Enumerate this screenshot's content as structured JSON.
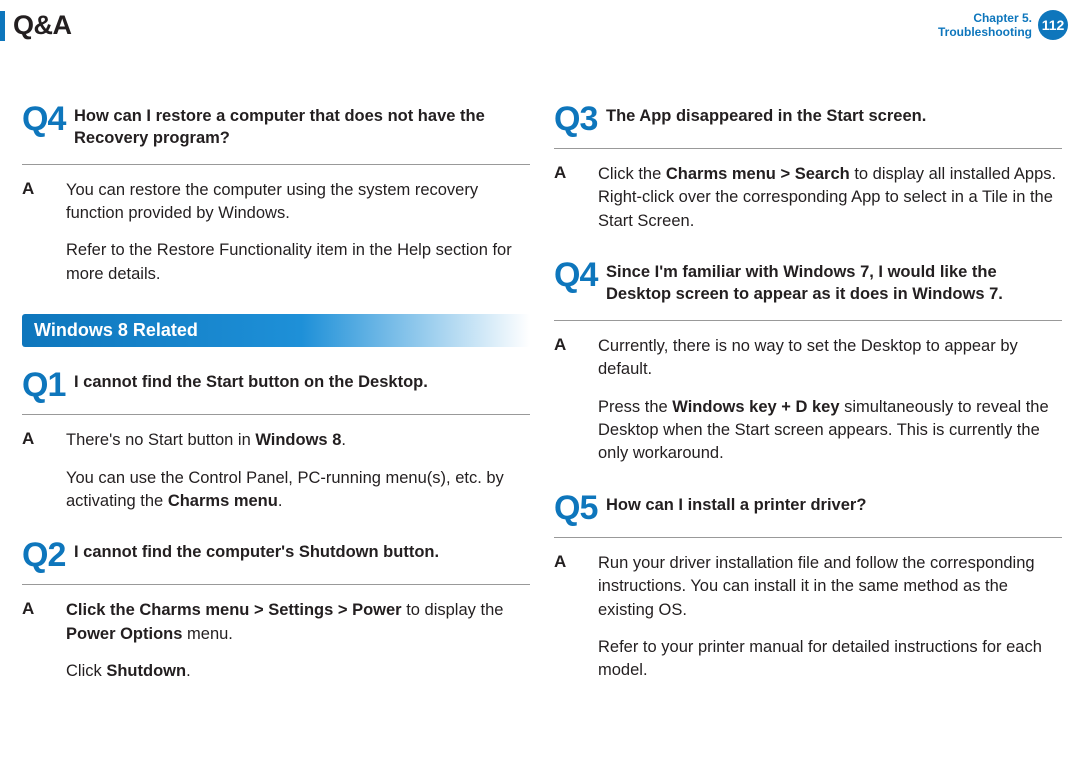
{
  "header": {
    "title": "Q&A",
    "chapter_line1": "Chapter 5.",
    "chapter_line2": "Troubleshooting",
    "page_number": "112"
  },
  "left": {
    "qa4": {
      "num": "Q4",
      "question": "How can I restore a computer that does not have the Recovery program?",
      "a_label": "A",
      "p1": "You can restore the computer using the system recovery function provided by Windows.",
      "p2": "Refer to the Restore Functionality item in the Help section for more details."
    },
    "section": "Windows 8 Related",
    "qa1": {
      "num": "Q1",
      "question": "I cannot find the Start button on the Desktop.",
      "a_label": "A",
      "p1_pre": "There's no Start button in ",
      "p1_bold": "Windows 8",
      "p1_post": ".",
      "p2_pre": "You can use the Control Panel, PC-running menu(s), etc. by activating the ",
      "p2_bold": "Charms menu",
      "p2_post": "."
    },
    "qa2": {
      "num": "Q2",
      "question": "I cannot find the computer's Shutdown button.",
      "a_label": "A",
      "p1_b1": "Click the Charms menu > Settings > Power",
      "p1_mid": " to display the ",
      "p1_b2": "Power Options",
      "p1_post": " menu.",
      "p2_pre": "Click ",
      "p2_bold": "Shutdown",
      "p2_post": "."
    }
  },
  "right": {
    "qa3": {
      "num": "Q3",
      "question": "The App disappeared in the Start screen.",
      "a_label": "A",
      "p1_pre": "Click the ",
      "p1_bold": "Charms menu > Search",
      "p1_post": " to display all installed Apps. Right-click over the corresponding App to select in a Tile in the Start Screen."
    },
    "qa4r": {
      "num": "Q4",
      "question": "Since I'm familiar with Windows 7, I would like the Desktop screen to appear as it does in Windows 7.",
      "a_label": "A",
      "p1": "Currently, there is no way to set the Desktop to appear by default.",
      "p2_pre": "Press the ",
      "p2_bold": "Windows key + D key",
      "p2_post": " simultaneously to reveal the Desktop when the Start screen appears. This is currently the only workaround."
    },
    "qa5": {
      "num": "Q5",
      "question": "How can I install a printer driver?",
      "a_label": "A",
      "p1": "Run your driver installation file and follow the corresponding instructions. You can install it in the same method as the existing OS.",
      "p2": "Refer to your printer manual for detailed instructions for each model."
    }
  }
}
